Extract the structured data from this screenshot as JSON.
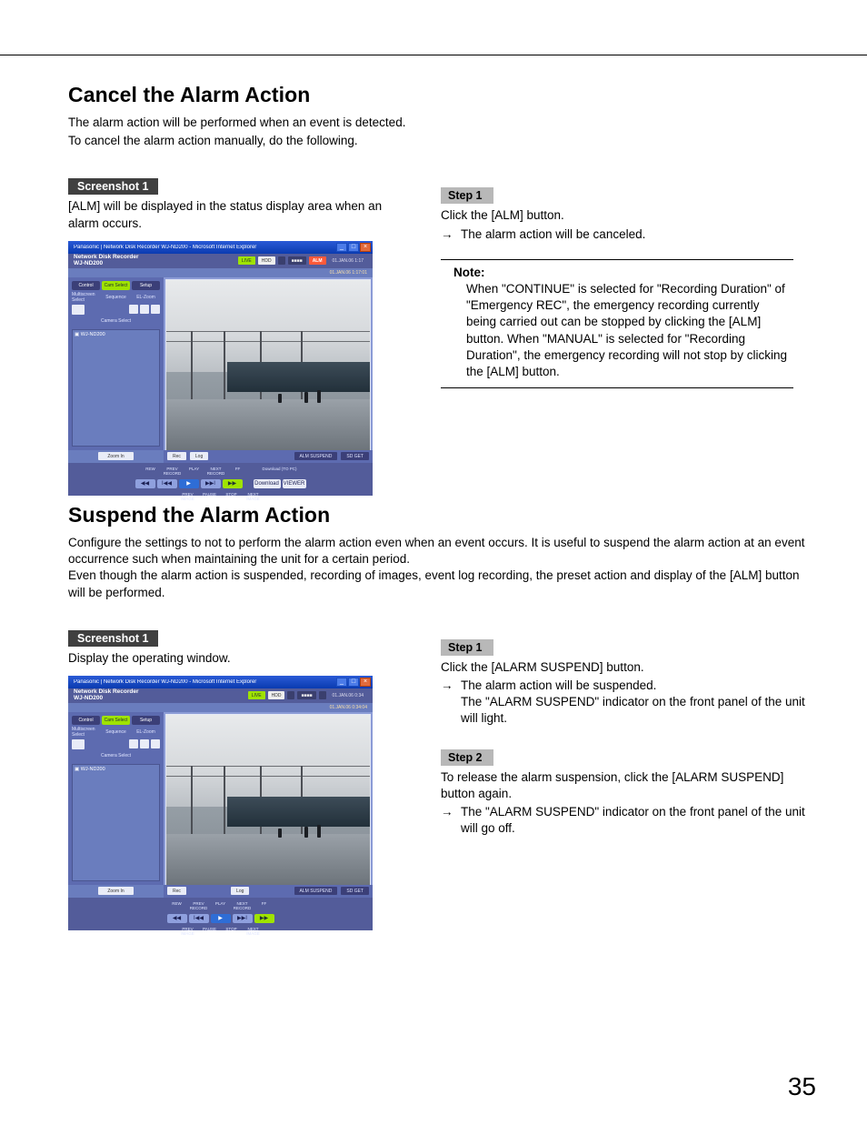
{
  "page_number": "35",
  "section1": {
    "title": "Cancel the Alarm Action",
    "intro_l1": "The alarm action will be performed when an event is detected.",
    "intro_l2": "To cancel the alarm action manually, do the following.",
    "screenshot_tag": "Screenshot 1",
    "screenshot_caption": "[ALM] will be displayed in the status display area when an alarm occurs.",
    "step1_tag": "Step 1",
    "step1_text": "Click the [ALM] button.",
    "step1_result": "The alarm action will be canceled.",
    "note_title": "Note:",
    "note_body": "When \"CONTINUE\" is selected for \"Recording Duration\" of \"Emergency REC\", the emergency recording currently being carried out can be stopped by clicking the [ALM] button. When \"MANUAL\" is selected for \"Recording Duration\", the emergency recording will not stop by clicking the [ALM] button."
  },
  "section2": {
    "title": "Suspend the Alarm Action",
    "intro": "Configure the settings to not to perform the alarm action even when an event occurs. It is useful to suspend the alarm action at an event occurrence such when maintaining the unit for a certain period.\nEven though the alarm action is suspended, recording of images, event log recording, the preset action and display of the [ALM] button will be performed.",
    "screenshot_tag": "Screenshot 1",
    "screenshot_caption": "Display the operating window.",
    "step1_tag": "Step 1",
    "step1_text": "Click the [ALARM SUSPEND] button.",
    "step1_result": "The alarm action will be suspended.\nThe \"ALARM SUSPEND\" indicator on the front panel of the unit will light.",
    "step2_tag": "Step 2",
    "step2_text": "To release the alarm suspension, click the [ALARM SUSPEND] button again.",
    "step2_result": "The \"ALARM SUSPEND\" indicator on the front panel of the unit will go off."
  },
  "mock": {
    "window_title": "Panasonic | Network Disk Recorder WJ-ND200 - Microsoft Internet Explorer",
    "product_brand": "Network Disk Recorder",
    "product_model": "WJ-ND200",
    "status_live": "LIVE",
    "status_hdd": "HDD",
    "status_alm": "ALM",
    "date1": "01.JAN.06  1:17",
    "date2": "01.JAN.06  0:34",
    "sub1": "01.JAN.06  1:17:01",
    "sub2": "01.JAN.06  0:34:04",
    "side_control": "Control",
    "side_cam": "Cam Select",
    "side_setup": "Setup",
    "side_multi": "Multiscreen Select",
    "side_seq": "Sequence",
    "side_el": "EL-Zoom",
    "side_camsel": "Camera Select",
    "tree1": "WJ-ND200",
    "foot_rec": "Rec",
    "foot_log": "Log",
    "dl_btn1": "Download",
    "dl_btn2": "VIEWER",
    "dl_label": "Download (TO PC)",
    "zoom": "Zoom In",
    "lbl_rew": "REW",
    "lbl_prec": "PREV RECORD",
    "lbl_play": "PLAY",
    "lbl_next": "NEXT RECORD",
    "lbl_ff": "FF",
    "lbl_pimg": "PREV IMAGE",
    "lbl_pause": "PAUSE",
    "lbl_stop": "STOP",
    "lbl_nimg": "NEXT IMAGE"
  }
}
